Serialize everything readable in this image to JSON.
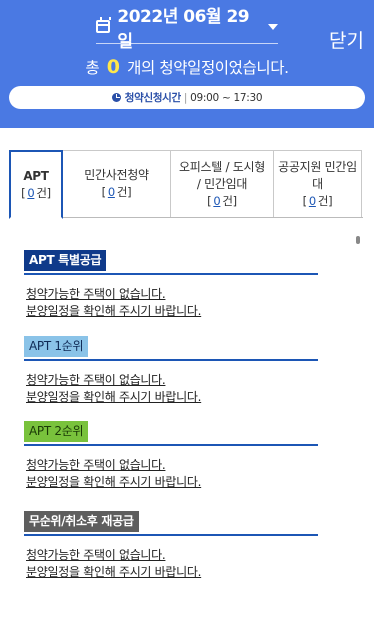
{
  "header": {
    "date": "2022년 06월 29일",
    "close_label": "닫기",
    "summary_prefix": "총",
    "summary_count": "0",
    "summary_suffix": "개의 청약일정이었습니다.",
    "hours_label": "청약신청시간",
    "hours_value": "09:00 ~ 17:30"
  },
  "tabs": [
    {
      "label": "APT",
      "count": "0",
      "unit": "건"
    },
    {
      "label": "민간사전청약",
      "count": "0",
      "unit": "건"
    },
    {
      "label_line1": "오피스텔 / 도시형",
      "label_line2": "/ 민간임대",
      "count": "0",
      "unit": "건"
    },
    {
      "label_line1": "공공지원 민간임",
      "label_line2": "대",
      "count": "0",
      "unit": "건"
    }
  ],
  "sections": [
    {
      "title": "APT 특별공급",
      "line1": "청약가능한 주택이 없습니다.",
      "line2": "분양일정을 확인해 주시기 바랍니다.",
      "color": "#0f3a8a"
    },
    {
      "title": "APT 1순위",
      "line1": "청약가능한 주택이 없습니다.",
      "line2": "분양일정을 확인해 주시기 바랍니다.",
      "color": "#8ac3e8"
    },
    {
      "title": "APT 2순위",
      "line1": "청약가능한 주택이 없습니다.",
      "line2": "분양일정을 확인해 주시기 바랍니다.",
      "color": "#79c23c"
    },
    {
      "title": "무순위/취소후 재공급",
      "line1": "청약가능한 주택이 없습니다.",
      "line2": "분양일정을 확인해 주시기 바랍니다.",
      "color": "#5e5e5e"
    }
  ],
  "icons": {
    "calendar": "calendar-icon",
    "dropdown": "chevron-down-icon",
    "clock": "clock-icon"
  },
  "colors": {
    "header_bg": "#4a79e3",
    "accent": "#1c56b5",
    "count_highlight": "#ffe74a"
  }
}
